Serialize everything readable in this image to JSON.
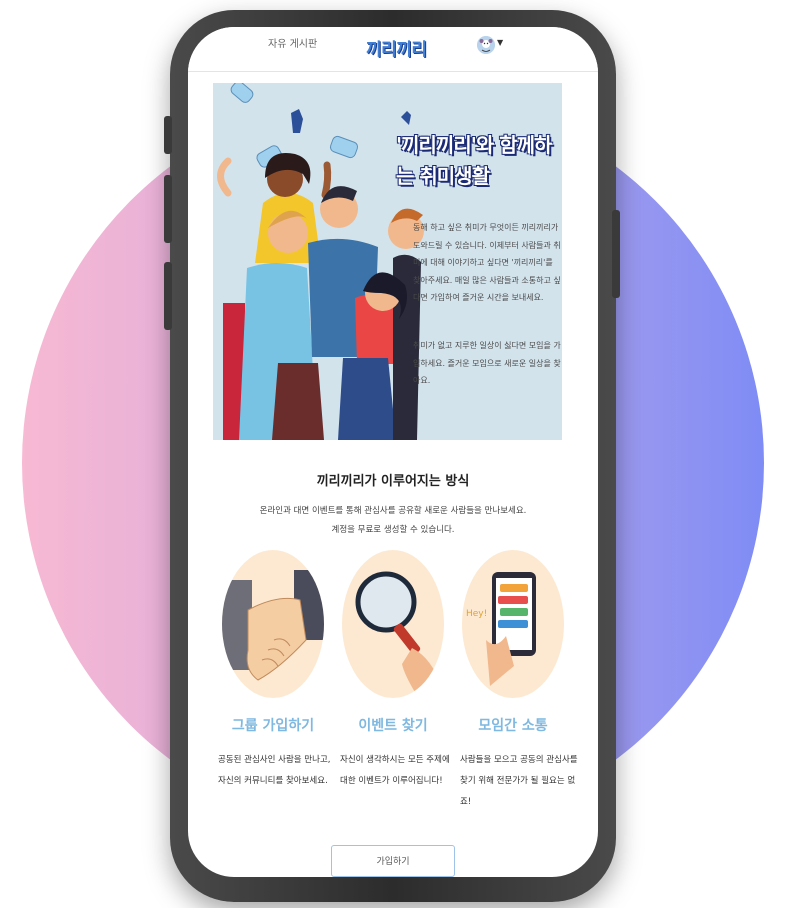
{
  "header": {
    "nav_link": "자유 게시판",
    "logo": "끼리끼리"
  },
  "hero": {
    "title": "'끼리끼리'와 함께하는 취미생활",
    "paragraph1": "동해 하고 싶은 취미가 무엇이든 끼리끼리가 도와드릴 수 있습니다. 이제부터 사람들과 취미에 대해 이야기하고 싶다면 '끼리끼리'를 찾아주세요. 매일 많은 사람들과 소통하고 싶다면 가입하여 즐거운 시간을 보내세요.",
    "paragraph2": "취미가 없고 지루한 일상이 싫다면 모임을 가입하세요. 즐거운 모임으로 새로운 일상을 찾아요."
  },
  "section": {
    "title": "끼리끼리가 이루어지는 방식",
    "subtitle_line1": "온라인과 대면 이벤트를 통해 관심사를 공유할 새로운 사람들을 만나보세요.",
    "subtitle_line2": "계정을 무료로 생성할 수 있습니다."
  },
  "features": [
    {
      "title": "그룹 가입하기",
      "text": "공동된 관심사인 사람을 만나고, 자신의 커뮤니티를 찾아보세요.",
      "icon": "handshake-illustration"
    },
    {
      "title": "이벤트 찾기",
      "text": "자신이 생각하시는 모든 주제에 대한 이벤트가 이루어집니다!",
      "icon": "magnifier-illustration"
    },
    {
      "title": "모임간 소통",
      "text": "사람들을 모으고 공동의 관심사를 찾기 위해 전문가가 될 필요는 없죠!",
      "icon": "chat-phone-illustration"
    }
  ],
  "cta": {
    "join_label": "가입하기"
  },
  "colors": {
    "accent": "#7fb8e0",
    "logo": "#3f7fd6",
    "hero_bg": "#d3e3ec",
    "title_outline": "#1b2a74"
  }
}
